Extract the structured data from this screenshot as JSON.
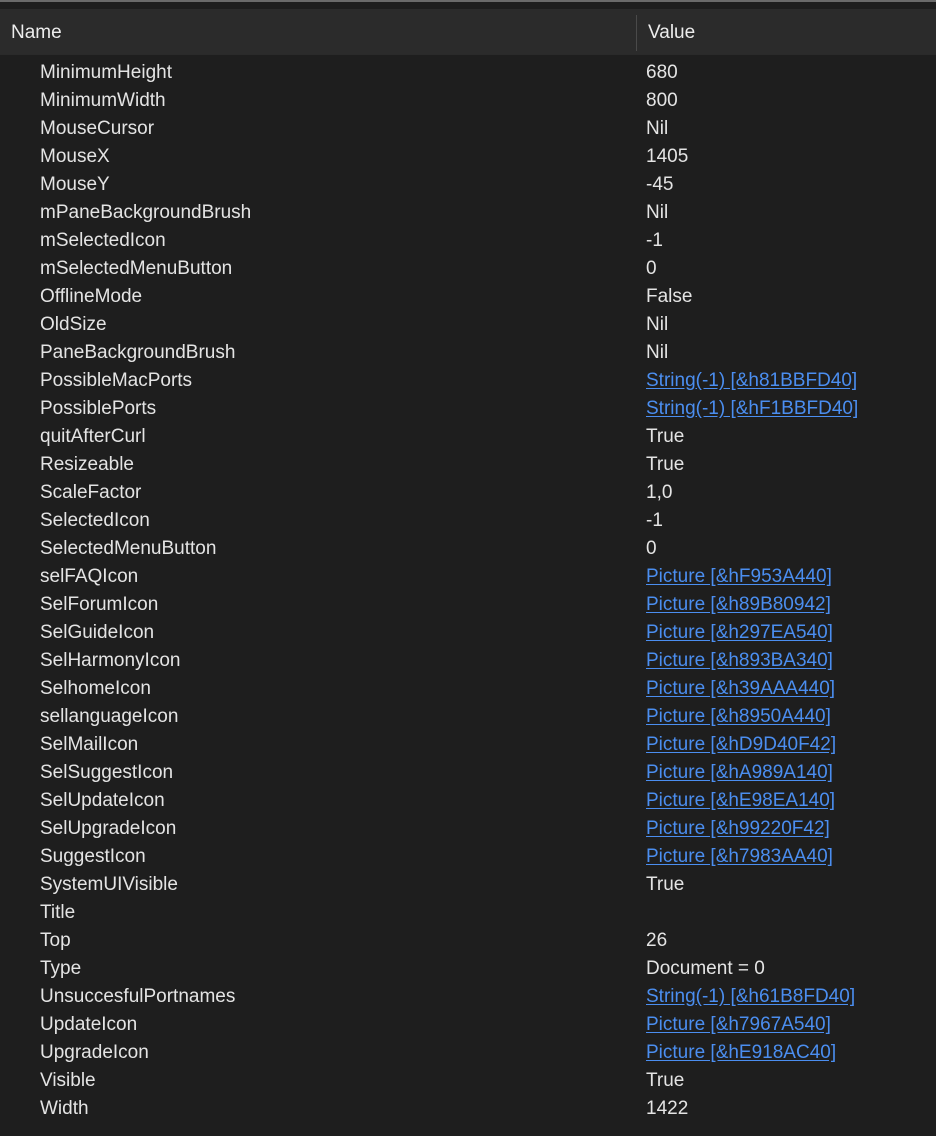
{
  "header": {
    "name_label": "Name",
    "value_label": "Value"
  },
  "colors": {
    "background": "#1e1e1e",
    "header_background": "#2b2b2b",
    "text": "#e4e4e4",
    "link": "#4b8ef0"
  },
  "rows": [
    {
      "name": "MinimumHeight",
      "value": "680",
      "link": false
    },
    {
      "name": "MinimumWidth",
      "value": "800",
      "link": false
    },
    {
      "name": "MouseCursor",
      "value": "Nil",
      "link": false
    },
    {
      "name": "MouseX",
      "value": "1405",
      "link": false
    },
    {
      "name": "MouseY",
      "value": "-45",
      "link": false
    },
    {
      "name": "mPaneBackgroundBrush",
      "value": "Nil",
      "link": false
    },
    {
      "name": "mSelectedIcon",
      "value": "-1",
      "link": false
    },
    {
      "name": "mSelectedMenuButton",
      "value": "0",
      "link": false
    },
    {
      "name": "OfflineMode",
      "value": "False",
      "link": false
    },
    {
      "name": "OldSize",
      "value": "Nil",
      "link": false
    },
    {
      "name": "PaneBackgroundBrush",
      "value": "Nil",
      "link": false
    },
    {
      "name": "PossibleMacPorts",
      "value": "String(-1) [&h81BBFD40]",
      "link": true
    },
    {
      "name": "PossiblePorts",
      "value": "String(-1) [&hF1BBFD40]",
      "link": true
    },
    {
      "name": "quitAfterCurl",
      "value": "True",
      "link": false
    },
    {
      "name": "Resizeable",
      "value": "True",
      "link": false
    },
    {
      "name": "ScaleFactor",
      "value": "1,0",
      "link": false
    },
    {
      "name": "SelectedIcon",
      "value": "-1",
      "link": false
    },
    {
      "name": "SelectedMenuButton",
      "value": "0",
      "link": false
    },
    {
      "name": "selFAQIcon",
      "value": "Picture [&hF953A440]",
      "link": true
    },
    {
      "name": "SelForumIcon",
      "value": "Picture [&h89B80942]",
      "link": true
    },
    {
      "name": "SelGuideIcon",
      "value": "Picture [&h297EA540]",
      "link": true
    },
    {
      "name": "SelHarmonyIcon",
      "value": "Picture [&h893BA340]",
      "link": true
    },
    {
      "name": "SelhomeIcon",
      "value": "Picture [&h39AAA440]",
      "link": true
    },
    {
      "name": "sellanguageIcon",
      "value": "Picture [&h8950A440]",
      "link": true
    },
    {
      "name": "SelMailIcon",
      "value": "Picture [&hD9D40F42]",
      "link": true
    },
    {
      "name": "SelSuggestIcon",
      "value": "Picture [&hA989A140]",
      "link": true
    },
    {
      "name": "SelUpdateIcon",
      "value": "Picture [&hE98EA140]",
      "link": true
    },
    {
      "name": "SelUpgradeIcon",
      "value": "Picture [&h99220F42]",
      "link": true
    },
    {
      "name": "SuggestIcon",
      "value": "Picture [&h7983AA40]",
      "link": true
    },
    {
      "name": "SystemUIVisible",
      "value": "True",
      "link": false
    },
    {
      "name": "Title",
      "value": "",
      "link": false
    },
    {
      "name": "Top",
      "value": "26",
      "link": false
    },
    {
      "name": "Type",
      "value": "Document = 0",
      "link": false
    },
    {
      "name": "UnsuccesfulPortnames",
      "value": "String(-1) [&h61B8FD40]",
      "link": true
    },
    {
      "name": "UpdateIcon",
      "value": "Picture [&h7967A540]",
      "link": true
    },
    {
      "name": "UpgradeIcon",
      "value": "Picture [&hE918AC40]",
      "link": true
    },
    {
      "name": "Visible",
      "value": "True",
      "link": false
    },
    {
      "name": "Width",
      "value": "1422",
      "link": false
    }
  ]
}
